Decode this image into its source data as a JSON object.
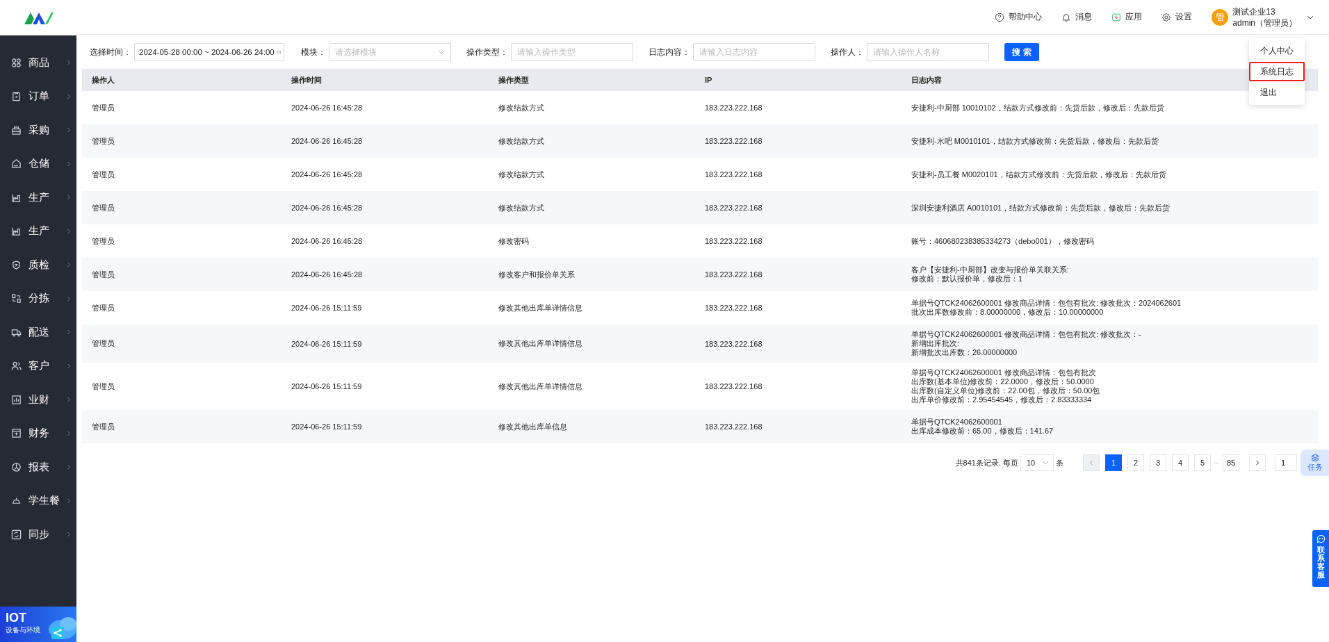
{
  "sidebar": {
    "items": [
      {
        "label": "商品"
      },
      {
        "label": "订单"
      },
      {
        "label": "采购"
      },
      {
        "label": "仓储"
      },
      {
        "label": "生产"
      },
      {
        "label": "生产"
      },
      {
        "label": "质检"
      },
      {
        "label": "分拣"
      },
      {
        "label": "配送"
      },
      {
        "label": "客户"
      },
      {
        "label": "业财"
      },
      {
        "label": "财务"
      },
      {
        "label": "报表"
      },
      {
        "label": "学生餐"
      },
      {
        "label": "同步"
      }
    ],
    "banner": {
      "title": "IOT",
      "subtitle": "设备与环境"
    }
  },
  "header": {
    "nav": [
      {
        "label": "帮助中心"
      },
      {
        "label": "消息"
      },
      {
        "label": "应用"
      },
      {
        "label": "设置"
      }
    ],
    "user": {
      "avatar": "管",
      "company": "测试企业13",
      "account": "admin（管理员）"
    },
    "menu": [
      {
        "label": "个人中心",
        "selected": false
      },
      {
        "label": "系统日志",
        "selected": true
      },
      {
        "label": "退出",
        "selected": false
      }
    ]
  },
  "filters": [
    {
      "label": "选择时间：",
      "kind": "daterange",
      "value": "2024-05-28 00:00 ~ 2024-06-26 24:00"
    },
    {
      "label": "模块：",
      "kind": "select",
      "placeholder": "请选择模块"
    },
    {
      "label": "操作类型：",
      "kind": "input",
      "placeholder": "请输入操作类型"
    },
    {
      "label": "日志内容：",
      "kind": "input",
      "placeholder": "请输入日志内容"
    },
    {
      "label": "操作人：",
      "kind": "input",
      "placeholder": "请输入操作人名称"
    }
  ],
  "search_button": "搜 索",
  "table": {
    "columns": [
      "操作人",
      "操作时间",
      "操作类型",
      "IP",
      "日志内容"
    ],
    "rows": [
      {
        "operator": "管理员",
        "time": "2024-06-26 16:45:28",
        "type": "修改结款方式",
        "ip": "183.223.222.168",
        "content": [
          "安捷利-中厨部 10010102，结款方式修改前：先货后款，修改后：先款后货"
        ]
      },
      {
        "operator": "管理员",
        "time": "2024-06-26 16:45:28",
        "type": "修改结款方式",
        "ip": "183.223.222.168",
        "content": [
          "安捷利-水吧 M0010101，结款方式修改前：先货后款，修改后：先款后货"
        ]
      },
      {
        "operator": "管理员",
        "time": "2024-06-26 16:45:28",
        "type": "修改结款方式",
        "ip": "183.223.222.168",
        "content": [
          "安捷利-员工餐 M0020101，结款方式修改前：先货后款，修改后：先款后货"
        ]
      },
      {
        "operator": "管理员",
        "time": "2024-06-26 16:45:28",
        "type": "修改结款方式",
        "ip": "183.223.222.168",
        "content": [
          "深圳安捷利酒店 A0010101，结款方式修改前：先货后款，修改后：先款后货"
        ]
      },
      {
        "operator": "管理员",
        "time": "2024-06-26 16:45:28",
        "type": "修改密码",
        "ip": "183.223.222.168",
        "content": [
          "账号：460680238385334273（debo001），修改密码"
        ]
      },
      {
        "operator": "管理员",
        "time": "2024-06-26 16:45:28",
        "type": "修改客户和报价单关系",
        "ip": "183.223.222.168",
        "content": [
          "客户【安捷利-中厨部】改变与报价单关联关系:",
          "修改前：默认报价单，修改后：1"
        ]
      },
      {
        "operator": "管理员",
        "time": "2024-06-26 15:11:59",
        "type": "修改其他出库单详情信息",
        "ip": "183.223.222.168",
        "content": [
          "单据号QTCK24062600001 修改商品详情：包包有批次: 修改批次：2024062601",
          "批次出库数修改前：8.00000000，修改后：10.00000000"
        ]
      },
      {
        "operator": "管理员",
        "time": "2024-06-26 15:11:59",
        "type": "修改其他出库单详情信息",
        "ip": "183.223.222.168",
        "content": [
          "单据号QTCK24062600001 修改商品详情：包包有批次: 修改批次：-",
          "新增出库批次:",
          "新增批次出库数：26.00000000"
        ]
      },
      {
        "operator": "管理员",
        "time": "2024-06-26 15:11:59",
        "type": "修改其他出库单详情信息",
        "ip": "183.223.222.168",
        "content": [
          "单据号QTCK24062600001 修改商品详情：包包有批次",
          "出库数(基本单位)修改前：22.0000，修改后：50.0000",
          "出库数(自定义单位)修改前：22.00包，修改后：50.00包",
          "出库单价修改前：2.95454545，修改后：2.83333334"
        ]
      },
      {
        "operator": "管理员",
        "time": "2024-06-26 15:11:59",
        "type": "修改其他出库单信息",
        "ip": "183.223.222.168",
        "content": [
          "单据号QTCK24062600001",
          "出库成本修改前：65.00，修改后：141.67"
        ]
      }
    ]
  },
  "pagination": {
    "total": "共841条记录. 每页",
    "page_size": "10",
    "unit": "条",
    "prev_disabled": true,
    "pages": [
      {
        "label": "1",
        "selected": true
      },
      {
        "label": "2",
        "selected": false
      },
      {
        "label": "3",
        "selected": false
      },
      {
        "label": "4",
        "selected": false
      },
      {
        "label": "5",
        "selected": false
      },
      {
        "label": "85",
        "selected": false
      }
    ],
    "ellipsis": "···",
    "jump": "1"
  },
  "float_buttons": [
    {
      "label": "任务",
      "kind": "task"
    },
    {
      "label": "联系客服",
      "kind": "contact"
    }
  ]
}
